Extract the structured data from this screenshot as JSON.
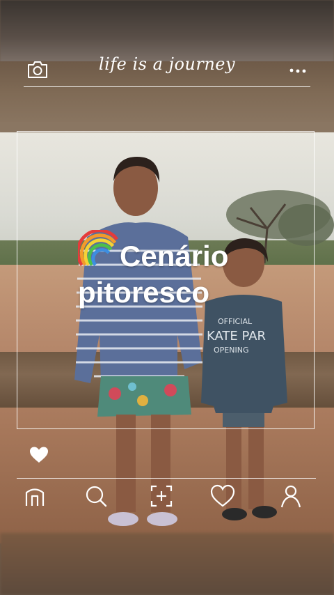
{
  "header": {
    "title": "life is a journey",
    "camera_icon": "camera-icon",
    "menu_icon": "more-dots-icon"
  },
  "caption": {
    "emoji_icon": "rainbow-icon",
    "line1": "Cenário",
    "line2": "pitoresco"
  },
  "like_icon": "heart-filled-icon",
  "bottom_nav": [
    {
      "icon": "home-icon"
    },
    {
      "icon": "search-icon"
    },
    {
      "icon": "add-post-icon"
    },
    {
      "icon": "heart-outline-icon"
    },
    {
      "icon": "profile-icon"
    }
  ],
  "photo": {
    "shirt_text_1": "OFFICIAL",
    "shirt_text_2": "KATE PAR",
    "shirt_text_3": "OPENING"
  }
}
